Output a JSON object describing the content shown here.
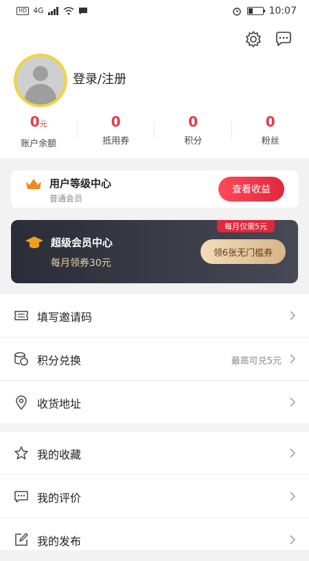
{
  "status_bar": {
    "left_badges": [
      "HD",
      "4G"
    ],
    "time": "10:07"
  },
  "header": {
    "login_text": "登录/注册"
  },
  "stats": [
    {
      "value": "0",
      "unit": "元",
      "label": "账户余额"
    },
    {
      "value": "0",
      "unit": "",
      "label": "抵用券"
    },
    {
      "value": "0",
      "unit": "",
      "label": "积分"
    },
    {
      "value": "0",
      "unit": "",
      "label": "粉丝"
    }
  ],
  "level_card": {
    "title": "用户等级中心",
    "subtitle": "普通会员",
    "button": "查看收益"
  },
  "vip_card": {
    "title": "超级会员中心",
    "subtitle": "每月领券30元",
    "tag": "每月仅需5元",
    "button": "领6张无门槛券"
  },
  "menu_group_1": [
    {
      "label": "填写邀请码",
      "hint": ""
    },
    {
      "label": "积分兑换",
      "hint": "最高可兑5元"
    },
    {
      "label": "收货地址",
      "hint": ""
    }
  ],
  "menu_group_2": [
    {
      "label": "我的收藏",
      "hint": ""
    },
    {
      "label": "我的评价",
      "hint": ""
    },
    {
      "label": "我的发布",
      "hint": ""
    }
  ],
  "colors": {
    "accent_red": "#e03b43",
    "vip_gold": "#e9d2a6",
    "avatar_ring": "#f1d43a"
  }
}
